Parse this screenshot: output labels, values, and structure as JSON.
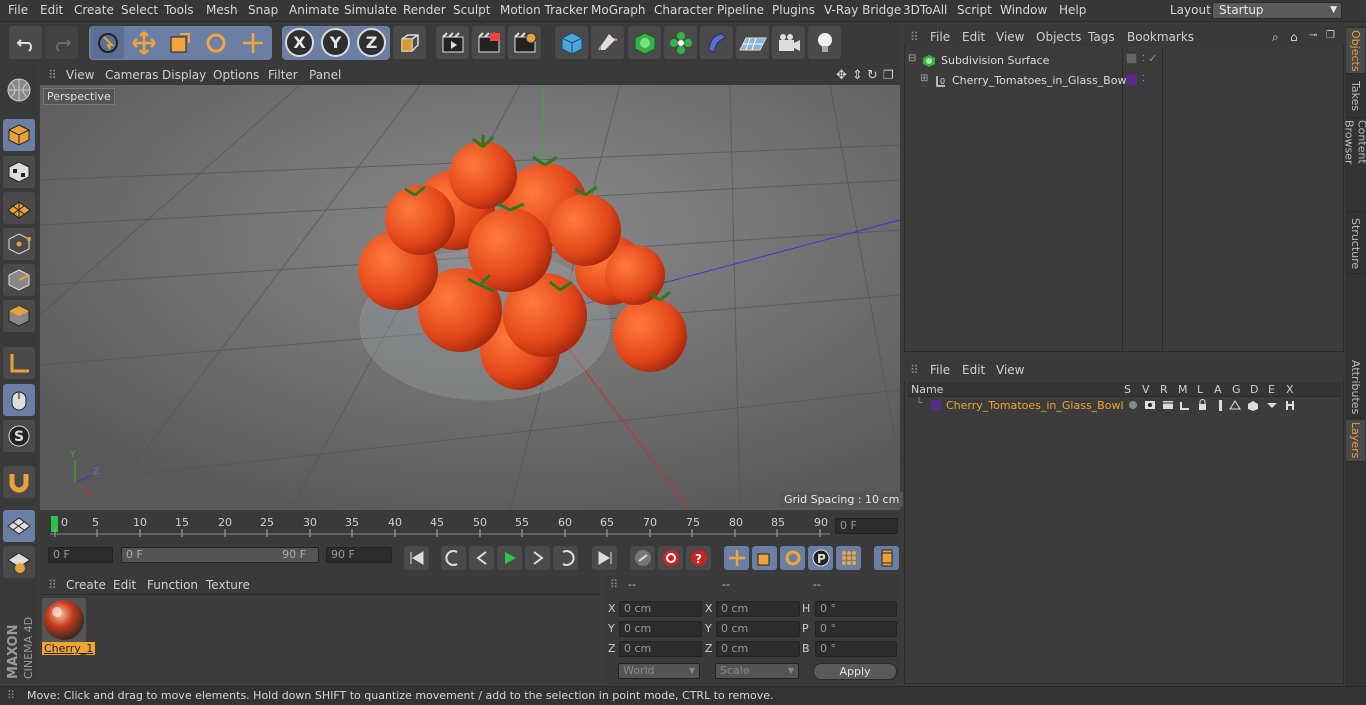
{
  "menubar": {
    "items": [
      "File",
      "Edit",
      "Create",
      "Select",
      "Tools",
      "Mesh",
      "Snap",
      "Animate",
      "Simulate",
      "Render",
      "Sculpt",
      "Motion Tracker",
      "MoGraph",
      "Character",
      "Pipeline",
      "Plugins",
      "V-Ray Bridge",
      "3DToAll",
      "Script",
      "Window",
      "Help"
    ],
    "layout_label": "Layout:",
    "layout_value": "Startup"
  },
  "viewport": {
    "menu": [
      "View",
      "Cameras",
      "Display",
      "Options",
      "Filter",
      "Panel"
    ],
    "camera_label": "Perspective",
    "grid_spacing": "Grid Spacing : 10 cm"
  },
  "timeline": {
    "ticks": [
      "0",
      "5",
      "10",
      "15",
      "20",
      "25",
      "30",
      "35",
      "40",
      "45",
      "50",
      "55",
      "60",
      "65",
      "70",
      "75",
      "80",
      "85",
      "90"
    ],
    "current_frame": "0 F",
    "start_frame": "0 F",
    "range_start": "0 F",
    "range_end": "90 F",
    "end_frame": "90 F"
  },
  "material_panel": {
    "menu": [
      "Create",
      "Edit",
      "Function",
      "Texture"
    ],
    "material_name": "Cherry_1"
  },
  "coords": {
    "headers": [
      "--",
      "--",
      "--"
    ],
    "rows": [
      {
        "a": "X",
        "av": "0 cm",
        "b": "X",
        "bv": "0 cm",
        "c": "H",
        "cv": "0 °"
      },
      {
        "a": "Y",
        "av": "0 cm",
        "b": "Y",
        "bv": "0 cm",
        "c": "P",
        "cv": "0 °"
      },
      {
        "a": "Z",
        "av": "0 cm",
        "b": "Z",
        "bv": "0 cm",
        "c": "B",
        "cv": "0 °"
      }
    ],
    "world": "World",
    "scale": "Scale",
    "apply": "Apply"
  },
  "objects_panel": {
    "menu": [
      "File",
      "Edit",
      "View",
      "Objects",
      "Tags",
      "Bookmarks"
    ],
    "items": [
      {
        "name": "Subdivision Surface"
      },
      {
        "name": "Cherry_Tomatoes_in_Glass_Bowl"
      }
    ]
  },
  "layers_panel": {
    "menu": [
      "File",
      "Edit",
      "View"
    ],
    "header_name": "Name",
    "columns": [
      "S",
      "V",
      "R",
      "M",
      "L",
      "A",
      "G",
      "D",
      "E",
      "X"
    ],
    "row_name": "Cherry_Tomatoes_in_Glass_Bowl"
  },
  "right_tabs": [
    "Objects",
    "Takes",
    "Content Browser",
    "Structure",
    "Attributes",
    "Layers"
  ],
  "status": "Move: Click and drag to move elements. Hold down SHIFT to quantize movement / add to the selection in point mode, CTRL to remove.",
  "brand": {
    "line1": "MAXON",
    "line2": "CINEMA 4D"
  },
  "colors": {
    "accent": "#6b7ea3",
    "orange": "#f0a530",
    "layer_color": "#5a2a88"
  }
}
